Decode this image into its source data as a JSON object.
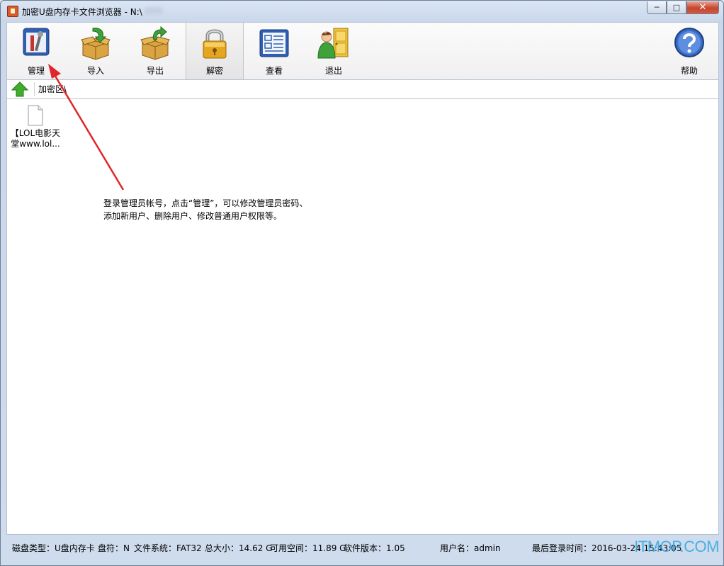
{
  "window": {
    "title": "加密U盘内存卡文件浏览器 - N:\\",
    "controls": {
      "minimize": "─",
      "maximize": "□",
      "close": "✕"
    }
  },
  "toolbar": {
    "items": [
      {
        "label": "管理",
        "icon": "manage-icon"
      },
      {
        "label": "导入",
        "icon": "import-box-icon"
      },
      {
        "label": "导出",
        "icon": "export-box-icon"
      },
      {
        "label": "解密",
        "icon": "padlock-icon"
      },
      {
        "label": "查看",
        "icon": "view-document-icon"
      },
      {
        "label": "退出",
        "icon": "exit-door-icon"
      },
      {
        "label": "帮助",
        "icon": "help-icon"
      }
    ],
    "active_index": 3
  },
  "pathbar": {
    "path": "加密区\\"
  },
  "files": [
    {
      "name": "【LOL电影天堂www.lol...",
      "icon": "blank-file-icon"
    }
  ],
  "annotation": {
    "line1": "登录管理员帐号，点击“管理”，可以修改管理员密码、",
    "line2": "添加新用户、删除用户、修改普通用户权限等。"
  },
  "status": {
    "disk_type": "磁盘类型：U盘内存卡",
    "drive_letter": "盘符：N",
    "filesystem": "文件系统：FAT32",
    "total_size": "总大小：14.62 G",
    "free_space": "可用空间：11.89 G",
    "version": "软件版本：1.05",
    "username": "用户名：admin",
    "last_login": "最后登录时间：2016-03-24 15:43:05"
  },
  "watermark": "ITMOP.COM",
  "colors": {
    "annotation_arrow": "#e0262b",
    "up_arrow": "#3fae2a",
    "watermark": "#33a8e0"
  }
}
